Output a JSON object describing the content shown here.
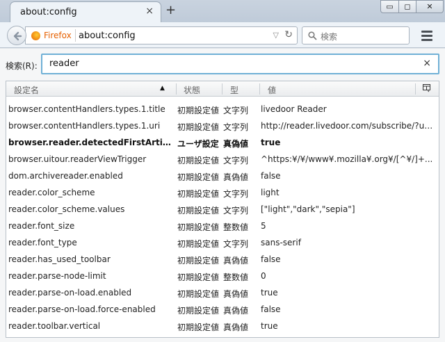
{
  "tabs": [
    {
      "title": "about:config",
      "close": "×"
    }
  ],
  "new_tab_label": "+",
  "window_controls": {
    "minimize": "▭",
    "maximize": "◻",
    "close": "✕"
  },
  "navbar": {
    "identity_label": "Firefox",
    "url": "about:config",
    "search_placeholder": "検索"
  },
  "filter": {
    "label": "検索(R):",
    "value": "reader",
    "clear": "×"
  },
  "columns": {
    "name": "設定名",
    "status": "状態",
    "type": "型",
    "value": "値"
  },
  "rows": [
    {
      "name": "browser.contentHandlers.types.1.title",
      "status": "初期設定値",
      "type": "文字列",
      "value": "livedoor Reader",
      "user_set": false
    },
    {
      "name": "browser.contentHandlers.types.1.uri",
      "status": "初期設定値",
      "type": "文字列",
      "value": "http://reader.livedoor.com/subscribe/?url...",
      "user_set": false
    },
    {
      "name": "browser.reader.detectedFirstArticle",
      "status": "ユーザ設定",
      "type": "真偽値",
      "value": "true",
      "user_set": true
    },
    {
      "name": "browser.uitour.readerViewTrigger",
      "status": "初期設定値",
      "type": "文字列",
      "value": "^https:¥/¥/www¥.mozilla¥.org¥/[^¥/]+...",
      "user_set": false
    },
    {
      "name": "dom.archivereader.enabled",
      "status": "初期設定値",
      "type": "真偽値",
      "value": "false",
      "user_set": false
    },
    {
      "name": "reader.color_scheme",
      "status": "初期設定値",
      "type": "文字列",
      "value": "light",
      "user_set": false
    },
    {
      "name": "reader.color_scheme.values",
      "status": "初期設定値",
      "type": "文字列",
      "value": "[\"light\",\"dark\",\"sepia\"]",
      "user_set": false
    },
    {
      "name": "reader.font_size",
      "status": "初期設定値",
      "type": "整数値",
      "value": "5",
      "user_set": false
    },
    {
      "name": "reader.font_type",
      "status": "初期設定値",
      "type": "文字列",
      "value": "sans-serif",
      "user_set": false
    },
    {
      "name": "reader.has_used_toolbar",
      "status": "初期設定値",
      "type": "真偽値",
      "value": "false",
      "user_set": false
    },
    {
      "name": "reader.parse-node-limit",
      "status": "初期設定値",
      "type": "整数値",
      "value": "0",
      "user_set": false
    },
    {
      "name": "reader.parse-on-load.enabled",
      "status": "初期設定値",
      "type": "真偽値",
      "value": "true",
      "user_set": false
    },
    {
      "name": "reader.parse-on-load.force-enabled",
      "status": "初期設定値",
      "type": "真偽値",
      "value": "false",
      "user_set": false
    },
    {
      "name": "reader.toolbar.vertical",
      "status": "初期設定値",
      "type": "真偽値",
      "value": "true",
      "user_set": false
    }
  ],
  "icons": {
    "back": "back-arrow-icon",
    "identity": "firefox-icon",
    "search": "search-icon",
    "menu": "hamburger-menu-icon",
    "column_picker": "column-picker-icon"
  },
  "colors": {
    "identity": "#e66000",
    "filter_focus_border": "#6fb0d6"
  }
}
